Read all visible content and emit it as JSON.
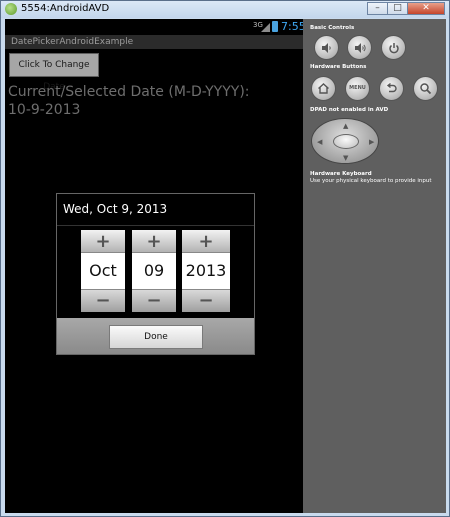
{
  "window": {
    "title": "5554:AndroidAVD",
    "minimize": "–",
    "maximize": "□",
    "close": "✕"
  },
  "statusbar": {
    "network": "3G",
    "time": "7:55"
  },
  "app": {
    "title": "DatePickerAndroidExample",
    "change_button": "Click To Change Date",
    "date_label": "Current/Selected Date (M-D-YYYY):",
    "date_value": "10-9-2013"
  },
  "dialog": {
    "title": "Wed, Oct 9, 2013",
    "pickers": [
      {
        "name": "month",
        "value": "Oct",
        "plus": "+",
        "minus": "−"
      },
      {
        "name": "day",
        "value": "09",
        "plus": "+",
        "minus": "−"
      },
      {
        "name": "year",
        "value": "2013",
        "plus": "+",
        "minus": "−"
      }
    ],
    "done_button": "Done"
  },
  "controls": {
    "basic_title": "Basic Controls",
    "hardware_title": "Hardware Buttons",
    "menu_label": "MENU",
    "dpad_title": "DPAD not enabled in AVD",
    "keyboard_title": "Hardware Keyboard",
    "keyboard_hint": "Use your physical keyboard to provide input",
    "icons": {
      "volume_down": "volume-down-icon",
      "volume_up": "volume-up-icon",
      "power": "power-icon",
      "home": "home-icon",
      "back": "back-icon",
      "search": "search-icon"
    }
  },
  "colors": {
    "statusbar_time": "#3fa9f5",
    "screen_background": "#000000",
    "controls_background": "#5f5f5f"
  }
}
